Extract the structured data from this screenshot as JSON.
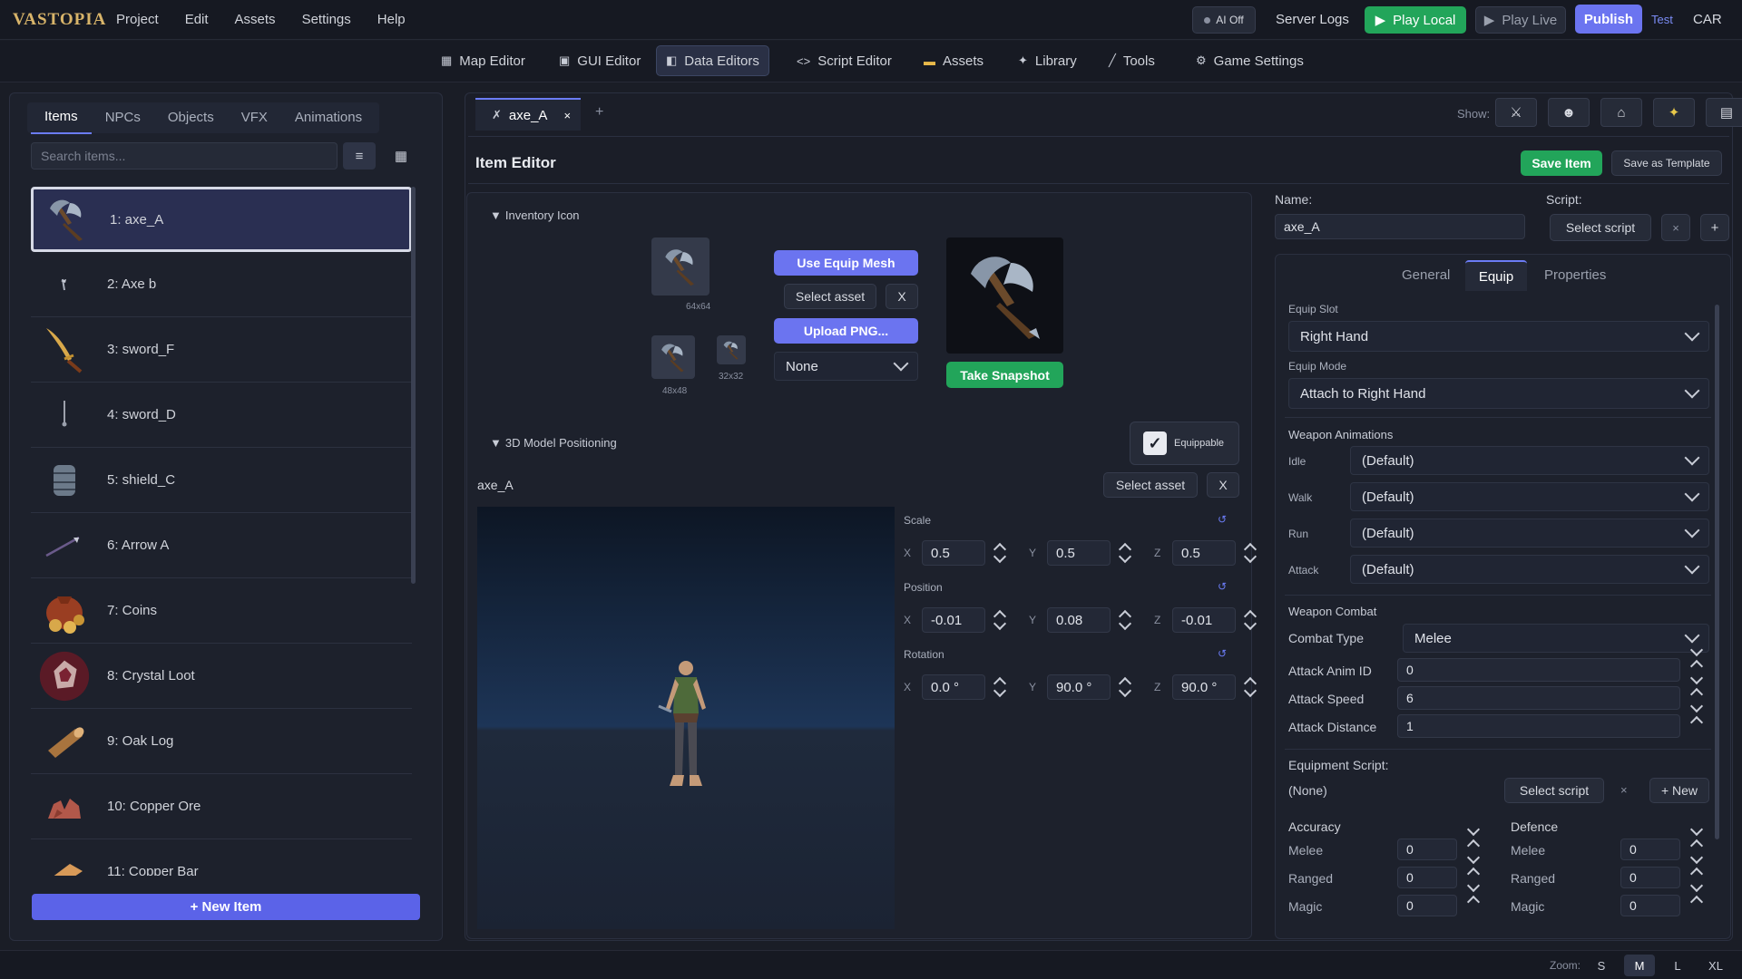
{
  "app": {
    "logo_text": "VASTOPIA"
  },
  "menu": [
    "Project",
    "Edit",
    "Assets",
    "Settings",
    "Help"
  ],
  "topbar": {
    "ai_off": "AI Off",
    "server_logs": "Server Logs",
    "play_local": "Play Local",
    "play_live": "Play Live",
    "publish": "Publish",
    "test": "Test",
    "car": "CAR"
  },
  "nav": [
    {
      "label": "Map Editor",
      "icon": "map-icon"
    },
    {
      "label": "GUI Editor",
      "icon": "gui-icon"
    },
    {
      "label": "Data Editors",
      "icon": "database-icon",
      "active": true
    },
    {
      "label": "Script Editor",
      "icon": "code-icon"
    },
    {
      "label": "Assets",
      "icon": "folder-icon"
    },
    {
      "label": "Library",
      "icon": "sparkle-icon"
    },
    {
      "label": "Tools",
      "icon": "wand-icon"
    },
    {
      "label": "Game Settings",
      "icon": "gear-icon"
    }
  ],
  "left": {
    "tabs": [
      "Items",
      "NPCs",
      "Objects",
      "VFX",
      "Animations"
    ],
    "search_placeholder": "Search items...",
    "items": [
      "1: axe_A",
      "2: Axe b",
      "3: sword_F",
      "4: sword_D",
      "5: shield_C",
      "6: Arrow A",
      "7: Coins",
      "8: Crystal Loot",
      "9: Oak Log",
      "10: Copper Ore",
      "11: Copper Bar"
    ],
    "new_item": "+ New Item"
  },
  "doc": {
    "tab_label": "axe_A",
    "close": "×",
    "add": "+"
  },
  "show": {
    "label": "Show:"
  },
  "editor": {
    "title": "Item Editor",
    "save_item": "Save Item",
    "save_template": "Save as Template",
    "inventory": {
      "heading": "Inventory Icon",
      "size_64": "64x64",
      "size_48": "48x48",
      "size_32": "32x32",
      "use_equip_mesh": "Use Equip Mesh",
      "select_asset": "Select asset",
      "clear": "X",
      "upload_png": "Upload PNG...",
      "none": "None",
      "take_snapshot": "Take Snapshot"
    },
    "model": {
      "heading": "3D Model Positioning",
      "equippable": "Equippable",
      "asset_name": "axe_A",
      "select_asset": "Select asset",
      "clear": "X",
      "scale_label": "Scale",
      "position_label": "Position",
      "rotation_label": "Rotation",
      "axes": [
        "X",
        "Y",
        "Z"
      ],
      "scale": [
        "0.5",
        "0.5",
        "0.5"
      ],
      "position": [
        "-0.01",
        "0.08",
        "-0.01"
      ],
      "rotation": [
        "0.0 °",
        "90.0 °",
        "90.0 °"
      ]
    }
  },
  "props": {
    "name_label": "Name:",
    "name_value": "axe_A",
    "script_label": "Script:",
    "select_script": "Select script",
    "x": "×",
    "plus": "+",
    "tabs": [
      "General",
      "Equip",
      "Properties"
    ],
    "equip_slot_label": "Equip Slot",
    "equip_slot": "Right Hand",
    "equip_mode_label": "Equip Mode",
    "equip_mode": "Attach to Right Hand",
    "weapon_anims_label": "Weapon Animations",
    "anims": [
      {
        "k": "Idle",
        "v": "(Default)"
      },
      {
        "k": "Walk",
        "v": "(Default)"
      },
      {
        "k": "Run",
        "v": "(Default)"
      },
      {
        "k": "Attack",
        "v": "(Default)"
      }
    ],
    "weapon_combat_label": "Weapon Combat",
    "combat_type_label": "Combat Type",
    "combat_type": "Melee",
    "attack_anim_label": "Attack Anim ID",
    "attack_anim": "0",
    "attack_speed_label": "Attack Speed",
    "attack_speed": "6",
    "attack_distance_label": "Attack Distance",
    "attack_distance": "1",
    "equip_script_label": "Equipment Script:",
    "equip_script_value": "(None)",
    "new": "+ New",
    "accuracy_label": "Accuracy",
    "defence_label": "Defence",
    "stats": [
      {
        "k": "Melee",
        "v": "0"
      },
      {
        "k": "Ranged",
        "v": "0"
      },
      {
        "k": "Magic",
        "v": "0"
      }
    ],
    "defence": [
      {
        "k": "Melee",
        "v": "0"
      },
      {
        "k": "Ranged",
        "v": "0"
      },
      {
        "k": "Magic",
        "v": "0"
      }
    ]
  },
  "bottom": {
    "zoom_label": "Zoom:",
    "sizes": [
      "S",
      "M",
      "L",
      "XL"
    ]
  }
}
